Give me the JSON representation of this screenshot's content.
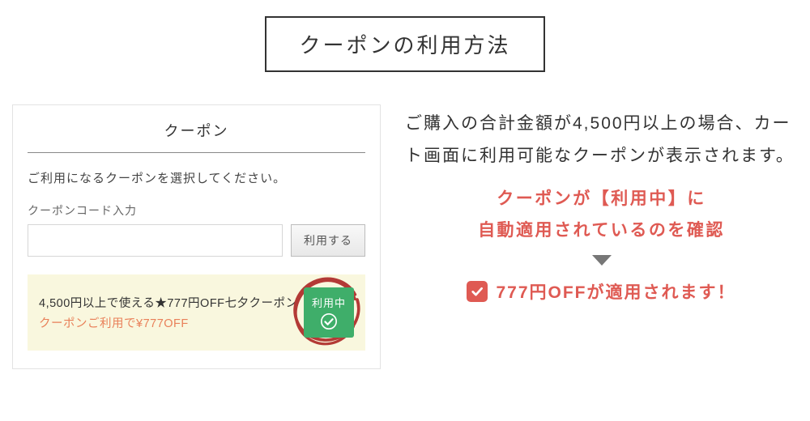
{
  "title": "クーポンの利用方法",
  "panel": {
    "heading": "クーポン",
    "instruction": "ご利用になるクーポンを選択してください。",
    "code_label": "クーポンコード入力",
    "code_value": "",
    "apply_button": "利用する",
    "coupon": {
      "title": "4,500円以上で使える★777円OFF七夕クーポン",
      "desc": "クーポンご利用で¥777OFF",
      "badge": "利用中"
    }
  },
  "explain": {
    "body": "ご購入の合計金額が4,500円以上の場合、カート画面に利用可能なクーポンが表示されます。",
    "highlight_line1": "クーポンが【利用中】に",
    "highlight_line2": "自動適用されているのを確認",
    "confirm": "777円OFFが適用されます！"
  },
  "colors": {
    "accent_red": "#df5a53",
    "accent_orange": "#e98059",
    "badge_green": "#3fae6a",
    "highlight_bg": "#f9f7de"
  }
}
